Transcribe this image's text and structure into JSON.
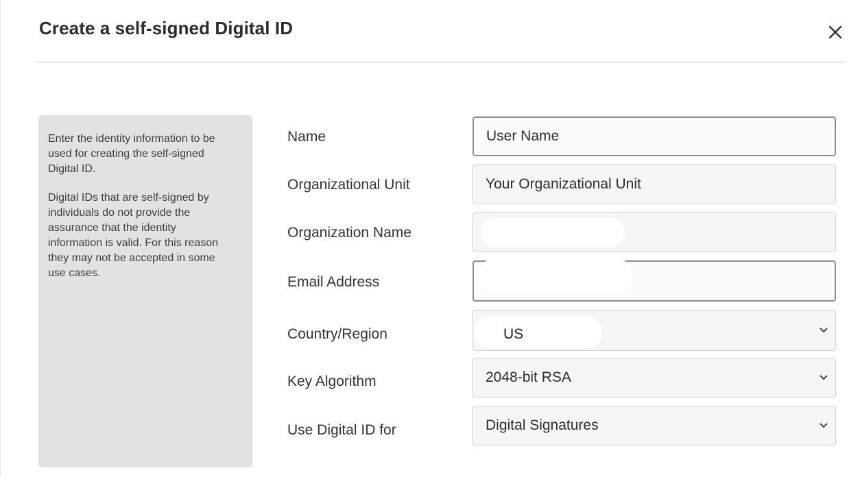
{
  "dialog": {
    "title": "Create a self-signed Digital ID",
    "close_label": "×"
  },
  "info": {
    "paragraph1": "Enter the identity information to be used for creating the self-signed Digital ID.",
    "paragraph2": "Digital IDs that are self-signed by individuals do not provide the assurance that the identity information is valid. For this reason they may not be accepted in some use cases."
  },
  "fields": {
    "name": {
      "label": "Name",
      "value": "User Name"
    },
    "org_unit": {
      "label": "Organizational Unit",
      "value": "Your Organizational Unit"
    },
    "org_name": {
      "label": "Organization Name",
      "value": ""
    },
    "email": {
      "label": "Email Address",
      "value": ""
    },
    "country": {
      "label": "Country/Region",
      "value": "US"
    },
    "key_algorithm": {
      "label": "Key Algorithm",
      "value": "2048-bit RSA"
    },
    "use_for": {
      "label": "Use Digital ID for",
      "value": "Digital Signatures"
    }
  },
  "icons": {
    "close": "close-icon",
    "dropdown": "chevron-down-icon"
  },
  "colors": {
    "panel_bg": "#e2e2e2",
    "field_bg": "#f6f6f6",
    "border": "#cfcfcf"
  }
}
